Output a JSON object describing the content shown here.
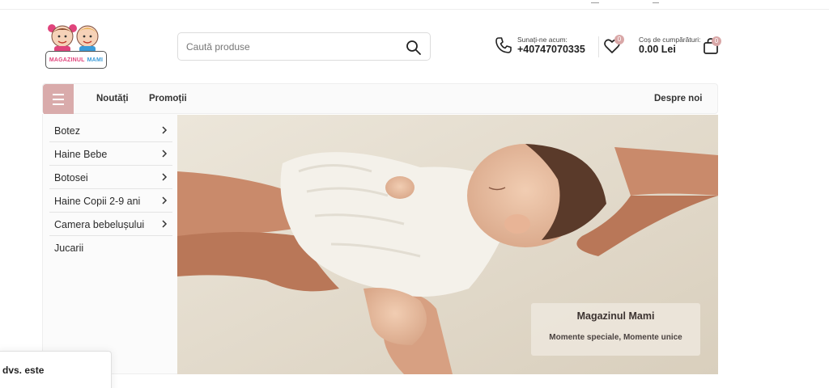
{
  "logo": {
    "word1": "MAGAZINUL",
    "word2": "MAMI",
    "icon": "kids-logo"
  },
  "search": {
    "placeholder": "Caută produse",
    "icon": "search-icon"
  },
  "contact": {
    "label": "Sunați-ne acum:",
    "phone": "+40747070335",
    "icon": "phone-icon"
  },
  "wishlist": {
    "icon": "heart-icon",
    "count": "0"
  },
  "cart": {
    "label": "Coș de cumpărături:",
    "total": "0.00 Lei",
    "count": "0",
    "icon": "bag-icon"
  },
  "nav": {
    "menu_icon": "hamburger-icon",
    "links": [
      "Noutăți",
      "Promoții"
    ],
    "right_link": "Despre noi"
  },
  "categories": [
    {
      "label": "Botez",
      "has_sub": true
    },
    {
      "label": "Haine Bebe",
      "has_sub": true
    },
    {
      "label": "Botosei",
      "has_sub": true
    },
    {
      "label": "Haine Copii 2-9 ani",
      "has_sub": true
    },
    {
      "label": "Camera bebelușului",
      "has_sub": true
    },
    {
      "label": "Jucarii",
      "has_sub": false
    }
  ],
  "hero": {
    "title": "Magazinul Mami",
    "subtitle": "Momente speciale, Momente unice"
  },
  "cookie": {
    "text": "dvs. este"
  },
  "colors": {
    "accent": "#d9abab",
    "badge": "#d9a7a7",
    "logo_pink": "#e0447c",
    "logo_blue": "#3a9bd8"
  }
}
